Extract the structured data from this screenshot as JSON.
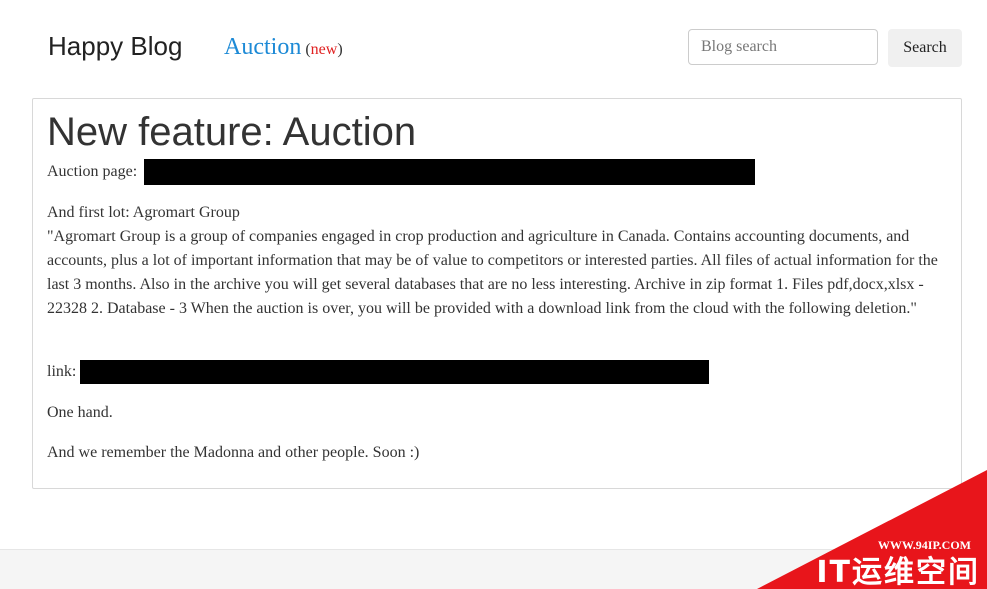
{
  "header": {
    "brand": "Happy Blog",
    "nav_auction": {
      "label": "Auction",
      "paren_open": "(",
      "badge": "new",
      "paren_close": ")"
    },
    "search": {
      "placeholder": "Blog search",
      "value": "",
      "button_label": "Search"
    }
  },
  "post": {
    "title": "New feature: Auction",
    "auction_page_label": "Auction page:",
    "first_lot": "And first lot: Agromart Group",
    "quote": "\"Agromart Group is a group of companies engaged in crop production and agriculture in Canada. Contains accounting documents, and accounts, plus a lot of important information that may be of value to competitors or interested parties. All files of actual information for the last 3 months. Also in the archive you will get several databases that are no less interesting. Archive in zip format 1. Files pdf,docx,xlsx - 22328 2. Database - 3 When the auction is over, you will be provided with a download link from the cloud with the following deletion.\"",
    "link_label": "link:",
    "one_hand": "One hand.",
    "closing": "And we remember the Madonna and other people. Soon :)"
  },
  "watermark": {
    "url": "WWW.94IP.COM",
    "brand": "IT运维空间",
    "colors": {
      "triangle": "#e8151b",
      "text": "#ffffff"
    }
  },
  "colors": {
    "nav_link": "#1d8ad6",
    "badge": "#e02020",
    "redaction": "#000000",
    "footer": "#f5f5f5"
  }
}
